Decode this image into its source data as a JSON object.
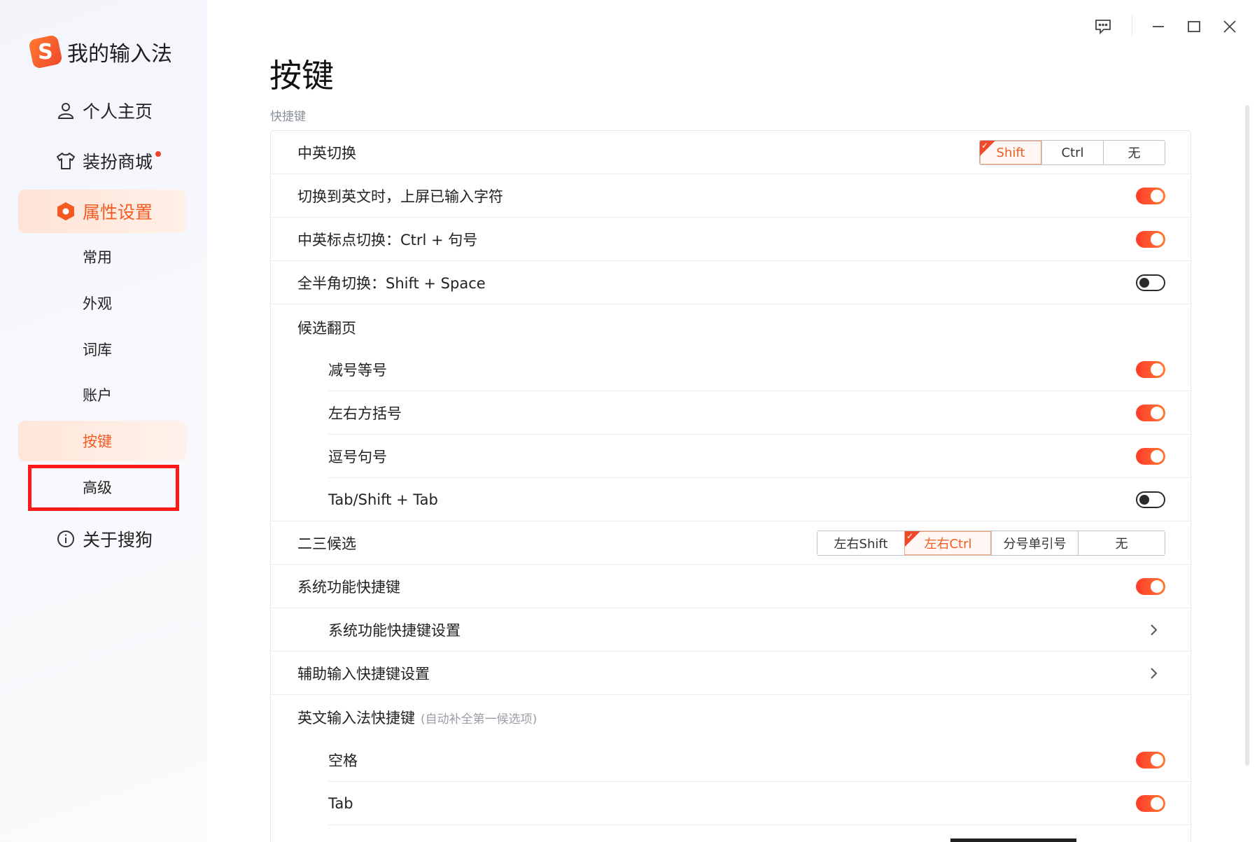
{
  "app": {
    "logo_letter": "S",
    "name": "我的输入法"
  },
  "colors": {
    "accent": "#f45a22",
    "toggle_on": "#ff4a2c",
    "highlight": "#ff1a1a"
  },
  "window_controls": {
    "icons": [
      "feedback-icon",
      "minimize-icon",
      "maximize-icon",
      "close-icon"
    ]
  },
  "sidebar": {
    "items": [
      {
        "label": "个人主页",
        "icon": "user-icon"
      },
      {
        "label": "装扮商城",
        "icon": "tshirt-icon",
        "has_dot": true
      },
      {
        "label": "属性设置",
        "icon": "hexagon-settings-icon",
        "active": true
      },
      {
        "label": "关于搜狗",
        "icon": "info-icon"
      }
    ],
    "sub_items": [
      {
        "label": "常用"
      },
      {
        "label": "外观"
      },
      {
        "label": "词库"
      },
      {
        "label": "账户"
      },
      {
        "label": "按键",
        "active": true
      },
      {
        "label": "高级",
        "highlighted": true
      }
    ]
  },
  "main": {
    "title": "按键",
    "section_label": "快捷键",
    "rows": {
      "cn_en_switch": {
        "label": "中英切换",
        "options": [
          "Shift",
          "Ctrl",
          "无"
        ],
        "selected": "Shift"
      },
      "commit_on_switch": {
        "label": "切换到英文时，上屏已输入字符",
        "on": true
      },
      "punct_switch": {
        "label": "中英标点切换：Ctrl + 句号",
        "on": true
      },
      "width_switch": {
        "label": "全半角切换：Shift + Space",
        "on": false
      },
      "paging_header": {
        "label": "候选翻页"
      },
      "paging_minus_equal": {
        "label": "减号等号",
        "on": true
      },
      "paging_brackets": {
        "label": "左右方括号",
        "on": true
      },
      "paging_comma_period": {
        "label": "逗号句号",
        "on": true
      },
      "paging_tab": {
        "label": "Tab/Shift + Tab",
        "on": false
      },
      "second_third": {
        "label": "二三候选",
        "options": [
          "左右Shift",
          "左右Ctrl",
          "分号单引号",
          "无"
        ],
        "selected": "左右Ctrl"
      },
      "system_shortcuts": {
        "label": "系统功能快捷键",
        "on": true
      },
      "system_shortcuts_settings": {
        "label": "系统功能快捷键设置"
      },
      "assist_shortcuts": {
        "label": "辅助输入快捷键设置"
      },
      "english_header": {
        "label": "英文输入法快捷键",
        "note": "(自动补全第一候选项)"
      },
      "english_space": {
        "label": "空格",
        "on": true
      },
      "english_tab": {
        "label": "Tab",
        "on": true
      }
    }
  }
}
